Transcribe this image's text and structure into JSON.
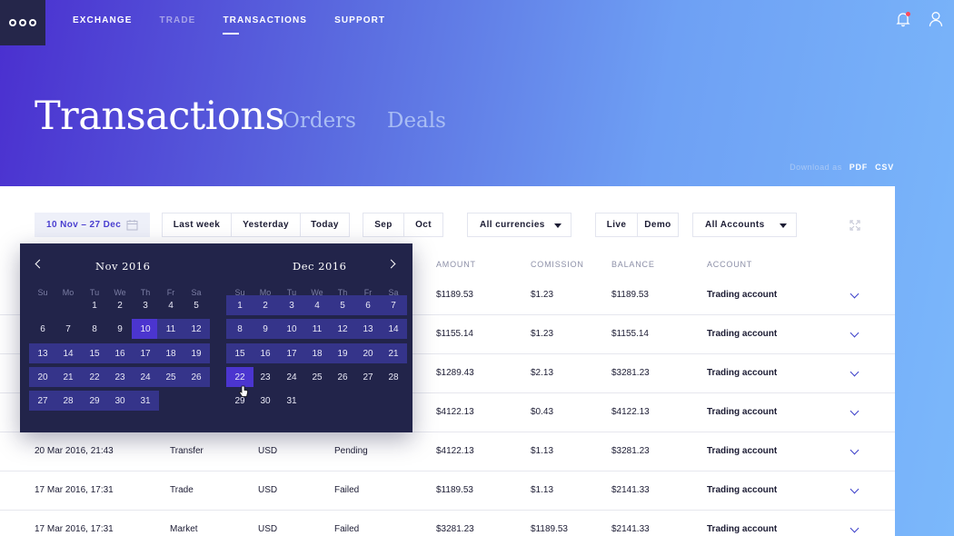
{
  "nav": {
    "items": [
      {
        "label": "EXCHANGE",
        "state": "normal"
      },
      {
        "label": "TRADE",
        "state": "dim"
      },
      {
        "label": "TRANSACTIONS",
        "state": "active"
      },
      {
        "label": "SUPPORT",
        "state": "normal"
      }
    ]
  },
  "header": {
    "title": "Transactions",
    "tabs": [
      "Orders",
      "Deals"
    ],
    "download_label": "Download as",
    "download_pdf": "PDF",
    "download_csv": "CSV"
  },
  "filters": {
    "date_range": "10 Nov – 27 Dec",
    "periods": [
      "Last week",
      "Yesterday",
      "Today"
    ],
    "months": [
      "Sep",
      "Oct"
    ],
    "currency": "All currencies",
    "modes": [
      "Live",
      "Demo"
    ],
    "accounts": "All Accounts"
  },
  "table": {
    "headers": [
      "AMOUNT",
      "COMISSION",
      "BALANCE",
      "ACCOUNT"
    ],
    "rows": [
      {
        "date": "",
        "type": "",
        "currency": "",
        "status": "",
        "amount": "$1189.53",
        "commission": "$1.23",
        "balance": "$1189.53",
        "account": "Trading account"
      },
      {
        "date": "",
        "type": "",
        "currency": "",
        "status": "",
        "amount": "$1155.14",
        "commission": "$1.23",
        "balance": "$1155.14",
        "account": "Trading account"
      },
      {
        "date": "",
        "type": "",
        "currency": "",
        "status": "",
        "amount": "$1289.43",
        "commission": "$2.13",
        "balance": "$3281.23",
        "account": "Trading account"
      },
      {
        "date": "",
        "type": "",
        "currency": "",
        "status": "",
        "amount": "$4122.13",
        "commission": "$0.43",
        "balance": "$4122.13",
        "account": "Trading account"
      },
      {
        "date": "20 Mar 2016, 21:43",
        "type": "Transfer",
        "currency": "USD",
        "status": "Pending",
        "amount": "$4122.13",
        "commission": "$1.13",
        "balance": "$3281.23",
        "account": "Trading account"
      },
      {
        "date": "17 Mar 2016, 17:31",
        "type": "Trade",
        "currency": "USD",
        "status": "Failed",
        "amount": "$1189.53",
        "commission": "$1.13",
        "balance": "$2141.33",
        "account": "Trading account"
      },
      {
        "date": "17 Mar 2016, 17:31",
        "type": "Market",
        "currency": "USD",
        "status": "Failed",
        "amount": "$3281.23",
        "commission": "$1189.53",
        "balance": "$2141.33",
        "account": "Trading account"
      }
    ]
  },
  "calendar": {
    "months": [
      "Nov 2016",
      "Dec 2016"
    ],
    "weekdays": [
      "Su",
      "Mo",
      "Tu",
      "We",
      "Th",
      "Fr",
      "Sa"
    ],
    "nov_first_weekday": 2,
    "nov_days": 31,
    "dec_first_weekday": 0,
    "dec_days": 31,
    "range_start": "10 Nov",
    "range_end": "22 Dec"
  }
}
